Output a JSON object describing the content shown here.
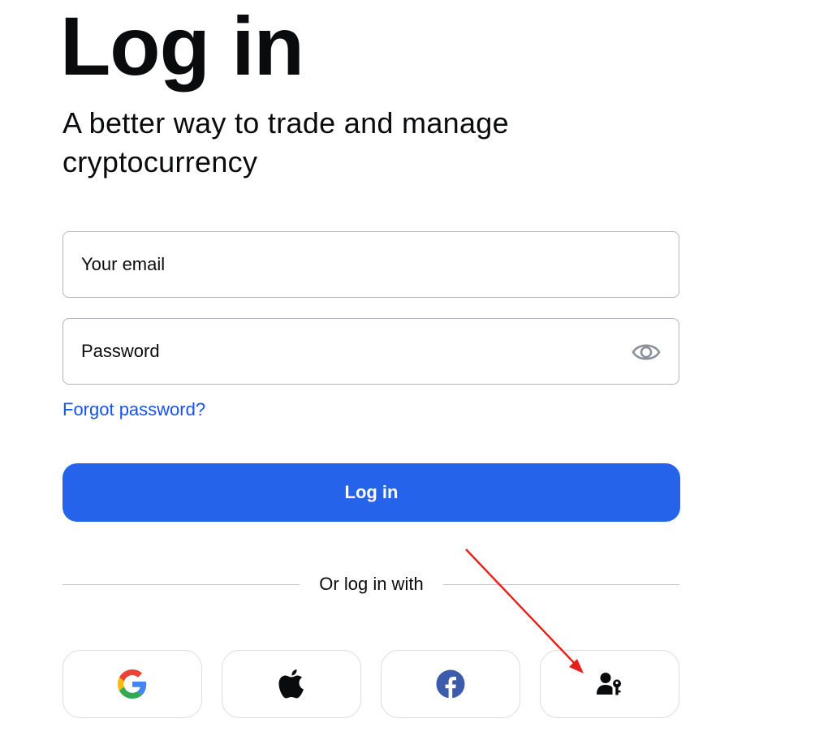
{
  "login": {
    "title": "Log in",
    "subtitle": "A better way to trade and manage cryptocurrency",
    "email": {
      "placeholder": "Your email",
      "value": ""
    },
    "password": {
      "placeholder": "Password",
      "value": "",
      "toggle_icon": "eye-icon"
    },
    "forgot_password_label": "Forgot password?",
    "submit_label": "Log in",
    "divider_label": "Or log in with",
    "social_providers": [
      {
        "id": "google",
        "icon": "google-icon"
      },
      {
        "id": "apple",
        "icon": "apple-icon"
      },
      {
        "id": "facebook",
        "icon": "facebook-icon"
      },
      {
        "id": "passkey",
        "icon": "passkey-icon"
      }
    ]
  },
  "colors": {
    "primary": "#2563eb",
    "link": "#1652f0",
    "text": "#0a0b0d",
    "border": "#b3b6bd",
    "annotation_arrow": "#e8201a"
  }
}
